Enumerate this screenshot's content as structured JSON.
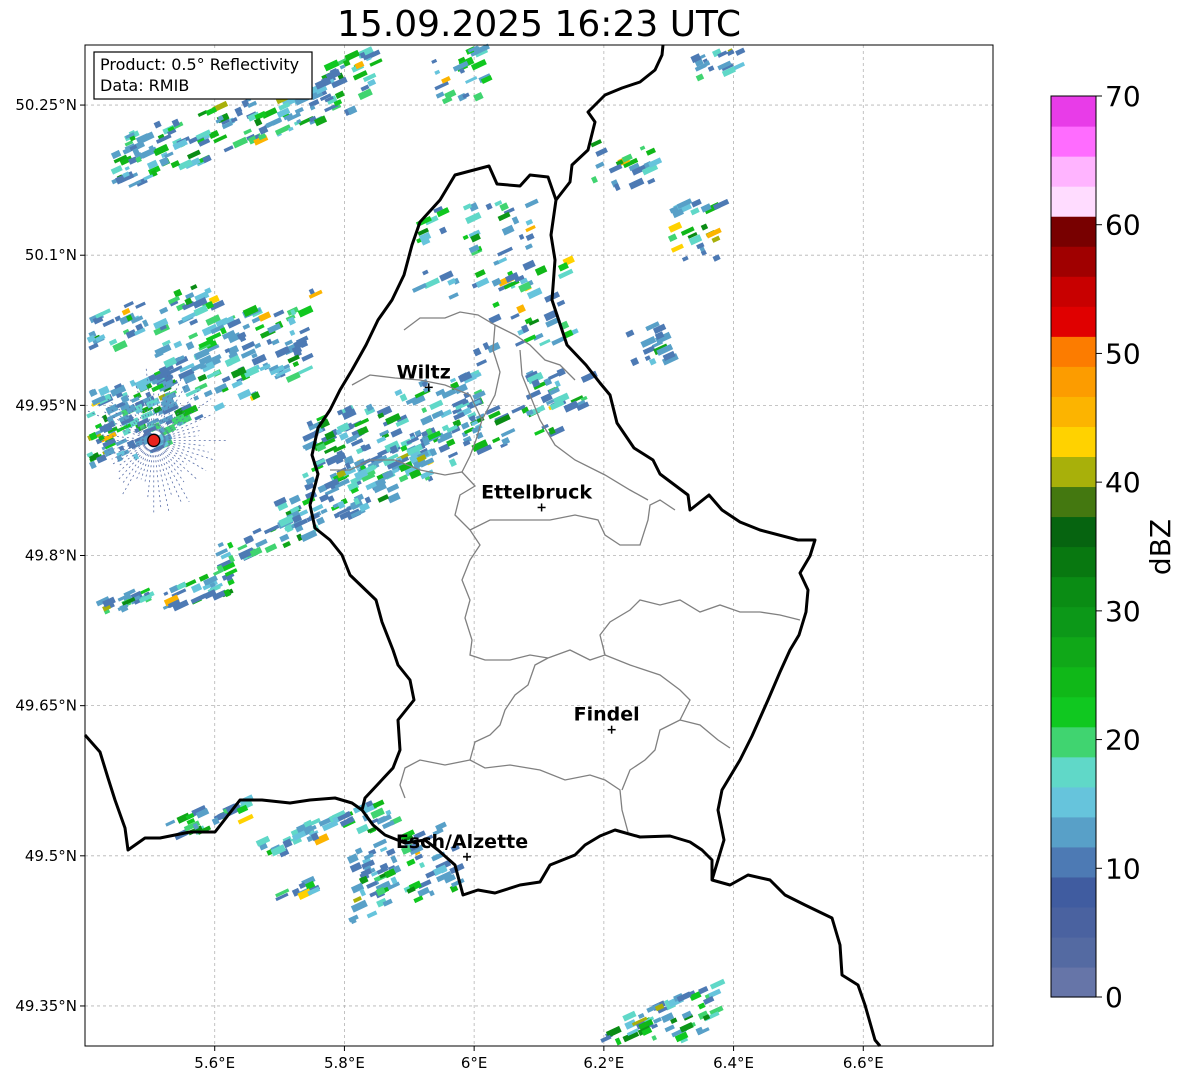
{
  "title": "15.09.2025 16:23 UTC",
  "info": {
    "product": "Product: 0.5° Reflectivity",
    "data": "Data: RMIB"
  },
  "map": {
    "lon_range": [
      5.4,
      6.8
    ],
    "lat_range": [
      49.31,
      50.31
    ],
    "grid": true,
    "lon_ticks": [
      {
        "value": 5.6,
        "label": "5.6°E"
      },
      {
        "value": 5.8,
        "label": "5.8°E"
      },
      {
        "value": 6.0,
        "label": "6°E"
      },
      {
        "value": 6.2,
        "label": "6.2°E"
      },
      {
        "value": 6.4,
        "label": "6.4°E"
      },
      {
        "value": 6.6,
        "label": "6.6°E"
      }
    ],
    "lat_ticks": [
      {
        "value": 50.25,
        "label": "50.25°N"
      },
      {
        "value": 50.1,
        "label": "50.1°N"
      },
      {
        "value": 49.95,
        "label": "49.95°N"
      },
      {
        "value": 49.8,
        "label": "49.8°N"
      },
      {
        "value": 49.65,
        "label": "49.65°N"
      },
      {
        "value": 49.5,
        "label": "49.5°N"
      },
      {
        "value": 49.35,
        "label": "49.35°N"
      }
    ],
    "radar_site": {
      "lon": 5.506,
      "lat": 49.915,
      "color": "#e8231c"
    },
    "cities": [
      {
        "name": "Wiltz",
        "lon": 5.93,
        "lat": 49.968
      },
      {
        "name": "Ettelbruck",
        "lon": 6.104,
        "lat": 49.848
      },
      {
        "name": "Findel",
        "lon": 6.212,
        "lat": 49.626
      },
      {
        "name": "Esch/Alzette",
        "lon": 5.989,
        "lat": 49.499
      }
    ]
  },
  "colorbar": {
    "label": "dBZ",
    "min": 0,
    "max": 70,
    "step": 2.5,
    "ticks": [
      0,
      10,
      20,
      30,
      40,
      50,
      60,
      70
    ],
    "tick_labels": [
      "0",
      "10",
      "20",
      "30",
      "40",
      "50",
      "60",
      "70"
    ],
    "colors": [
      "#6675a8",
      "#546aa2",
      "#4a62a0",
      "#405ca0",
      "#4d7ab4",
      "#58a0c8",
      "#66c4dc",
      "#60d8c8",
      "#40d470",
      "#10c820",
      "#10b818",
      "#10a818",
      "#0c9818",
      "#0a8c14",
      "#087810",
      "#066410",
      "#447810",
      "#a8b00a",
      "#ffd200",
      "#fcb400",
      "#fc9c00",
      "#fc7c00",
      "#e00000",
      "#c80000",
      "#a00000",
      "#780000",
      "#ffdcff",
      "#ffb4ff",
      "#ff6cff",
      "#e83ce8"
    ]
  }
}
